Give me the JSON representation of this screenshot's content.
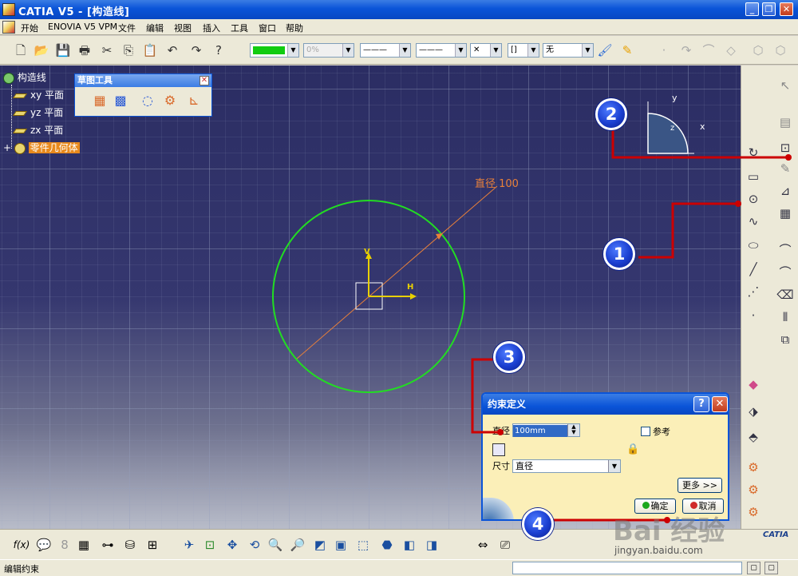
{
  "window": {
    "title": "CATIA V5 - [构造线]",
    "minimize_glyph": "_",
    "restore_glyph": "❐",
    "close_glyph": "✕"
  },
  "menubar": {
    "items": [
      "开始",
      "ENOVIA V5 VPM",
      "文件",
      "编辑",
      "视图",
      "插入",
      "工具",
      "窗口",
      "帮助"
    ]
  },
  "toolbar": {
    "color_combo": "",
    "percent_combo": "0%",
    "linetype_combo": "———",
    "thickness_combo": "———",
    "point_combo": "✕",
    "layer_combo": "[]",
    "none_combo": "无"
  },
  "tree": {
    "root": "构造线",
    "items": [
      "xy 平面",
      "yz 平面",
      "zx 平面"
    ],
    "body": "零件几何体"
  },
  "palette": {
    "title": "草图工具"
  },
  "sketch": {
    "dimension_label": "直径 100",
    "axis_v": "V",
    "axis_h": "H",
    "compass_x": "x",
    "compass_y": "y",
    "compass_z": "z",
    "circle_color": "#22dd22",
    "dimension_color": "#e8803a"
  },
  "dialog": {
    "title": "约束定义",
    "help_glyph": "?",
    "close_glyph": "✕",
    "diameter_label": "直径",
    "diameter_value": "100mm",
    "reference_label": "参考",
    "dimension_label": "尺寸",
    "dimension_value": "直径",
    "more_button": "更多 >>",
    "ok_button": "确定",
    "cancel_button": "取消"
  },
  "status": {
    "text": "编辑约束"
  },
  "markers": [
    "1",
    "2",
    "3",
    "4"
  ],
  "watermark": {
    "big": "Bai 经验",
    "url": "jingyan.baidu.com",
    "catia_logo": "CATIA"
  },
  "colors": {
    "marker_blue": "#1b3fd0",
    "leader_red": "#cc0000",
    "titlebar_blue": "#0a54d8"
  }
}
